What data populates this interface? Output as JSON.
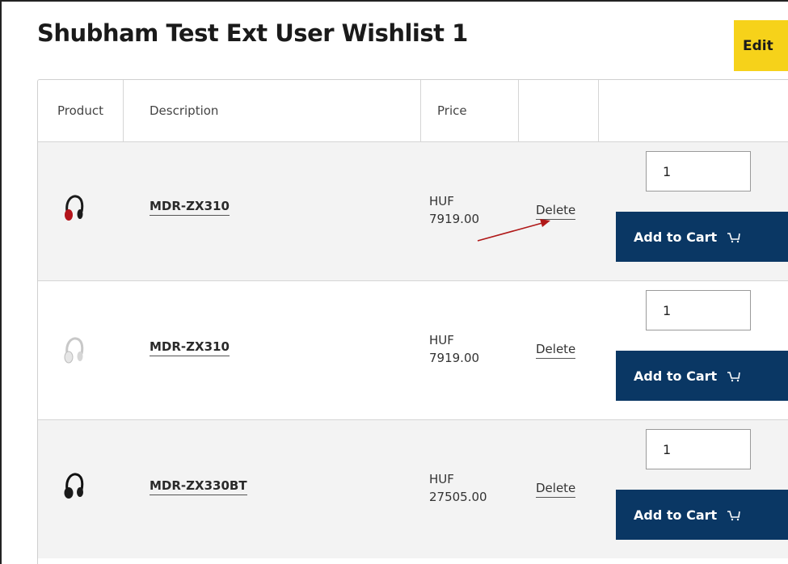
{
  "wishlist": {
    "title": "Shubham Test Ext User Wishlist 1",
    "edit_label": "Edit"
  },
  "table": {
    "headers": {
      "product": "Product",
      "description": "Description",
      "price": "Price",
      "actions": "",
      "cart": ""
    },
    "rows": [
      {
        "image_icon": "headphones-red-icon",
        "name": "MDR-ZX310",
        "currency": "HUF",
        "price": "7919.00",
        "delete_label": "Delete",
        "quantity": "1",
        "add_to_cart_label": "Add to Cart"
      },
      {
        "image_icon": "headphones-white-icon",
        "name": "MDR-ZX310",
        "currency": "HUF",
        "price": "7919.00",
        "delete_label": "Delete",
        "quantity": "1",
        "add_to_cart_label": "Add to Cart"
      },
      {
        "image_icon": "headphones-black-icon",
        "name": "MDR-ZX330BT",
        "currency": "HUF",
        "price": "27505.00",
        "delete_label": "Delete",
        "quantity": "1",
        "add_to_cart_label": "Add to Cart"
      }
    ]
  },
  "colors": {
    "edit_button": "#f6d21a",
    "cart_button": "#0a3764",
    "annotation_arrow": "#b01818"
  }
}
